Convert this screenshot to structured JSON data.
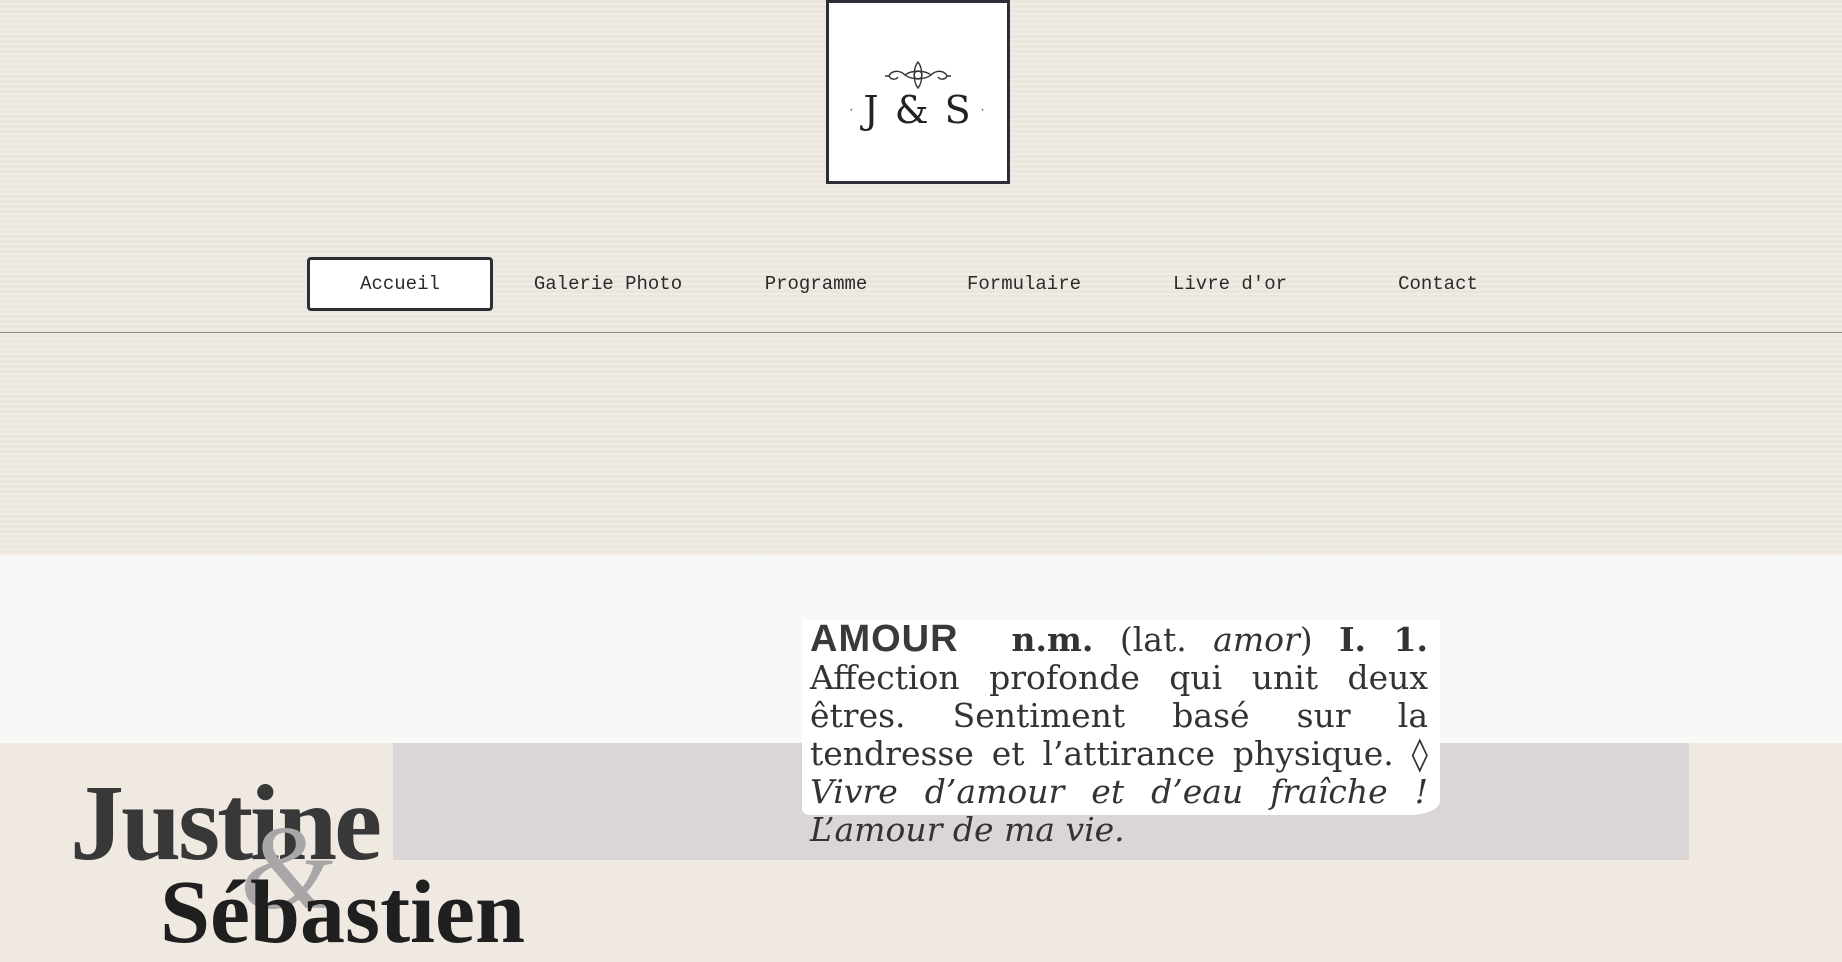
{
  "logo": {
    "text": "J & S",
    "dot_left": "·",
    "dot_right": "·"
  },
  "nav": {
    "items": [
      {
        "label": "Accueil",
        "active": true
      },
      {
        "label": "Galerie Photo",
        "active": false
      },
      {
        "label": "Programme",
        "active": false
      },
      {
        "label": "Formulaire",
        "active": false
      },
      {
        "label": "Livre d'or",
        "active": false
      },
      {
        "label": "Contact",
        "active": false
      }
    ]
  },
  "definition": {
    "word": "AMOUR",
    "grammar": "n.m.",
    "etym_open": "(lat.",
    "etym_word": "amor",
    "etym_close": ")",
    "sense": "I. 1.",
    "text": "Affection profonde qui unit deux êtres. Sentiment basé sur la tendresse et l’attirance physique. ◊",
    "example": "Vivre d’amour et d’eau fraîche ! L’amour de ma vie."
  },
  "names": {
    "first": "Justine",
    "ampersand": "&",
    "second": "Sébastien"
  },
  "colors": {
    "background": "#efe9e2",
    "border": "#2e2e36",
    "grey_band": "#dbd6d5",
    "white_band": "#f8f8f7"
  }
}
